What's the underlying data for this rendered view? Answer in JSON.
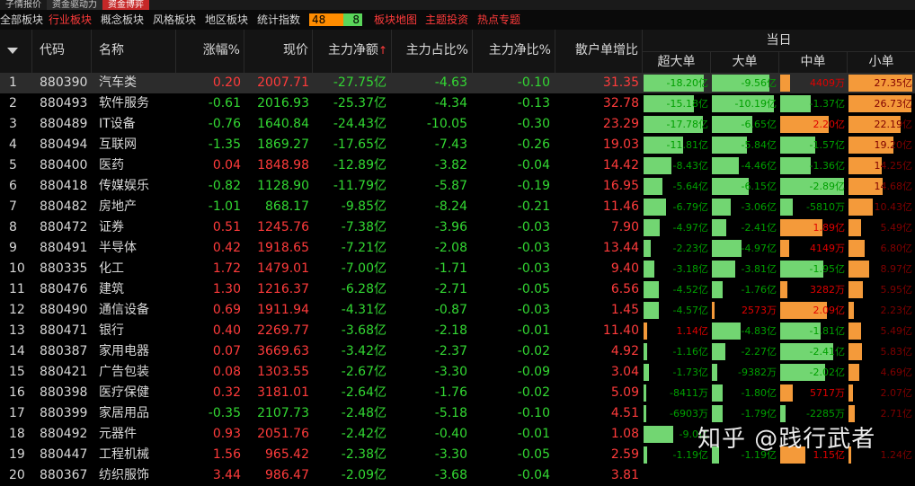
{
  "top_tabs": [
    "子情报价",
    "资金驱动力",
    "资金博弈"
  ],
  "categories": [
    "全部板块",
    "行业板块",
    "概念板块",
    "风格板块",
    "地区板块",
    "统计指数"
  ],
  "ratio_bar": {
    "up": "48",
    "down": "8"
  },
  "links": [
    "板块地图",
    "主题投资",
    "热点专题"
  ],
  "headers": {
    "code": "代码",
    "name": "名称",
    "chg": "涨幅%",
    "price": "现价",
    "net": "主力净额",
    "pct": "主力占比%",
    "net_ratio": "主力净比%",
    "retail": "散户单增比",
    "group": "当日",
    "xl": "超大单",
    "l": "大单",
    "m": "中单",
    "s": "小单"
  },
  "colors": {
    "up": "#ff3b3b",
    "down": "#33d833",
    "green_bar": "#72d672",
    "orange_bar": "#f49a3a"
  },
  "rows": [
    {
      "no": "1",
      "code": "880390",
      "name": "汽车类",
      "chg": "0.20",
      "price": "2007.71",
      "net": "-27.75亿",
      "pct": "-4.63",
      "nr": "-0.10",
      "retail": "31.35",
      "xl": "-18.20亿",
      "l": "-9.56亿",
      "m": "4409万",
      "s": "27.35亿"
    },
    {
      "no": "2",
      "code": "880493",
      "name": "软件服务",
      "chg": "-0.61",
      "price": "2016.93",
      "net": "-25.37亿",
      "pct": "-4.34",
      "nr": "-0.13",
      "retail": "32.78",
      "xl": "-15.18亿",
      "l": "-10.19亿",
      "m": "-1.37亿",
      "s": "26.73亿"
    },
    {
      "no": "3",
      "code": "880489",
      "name": "IT设备",
      "chg": "-0.76",
      "price": "1640.84",
      "net": "-24.43亿",
      "pct": "-10.05",
      "nr": "-0.30",
      "retail": "23.29",
      "xl": "-17.78亿",
      "l": "-6.65亿",
      "m": "2.20亿",
      "s": "22.19亿"
    },
    {
      "no": "4",
      "code": "880494",
      "name": "互联网",
      "chg": "-1.35",
      "price": "1869.27",
      "net": "-17.65亿",
      "pct": "-7.43",
      "nr": "-0.26",
      "retail": "19.03",
      "xl": "-11.81亿",
      "l": "-5.84亿",
      "m": "-1.57亿",
      "s": "19.20亿"
    },
    {
      "no": "5",
      "code": "880400",
      "name": "医药",
      "chg": "0.04",
      "price": "1848.98",
      "net": "-12.89亿",
      "pct": "-3.82",
      "nr": "-0.04",
      "retail": "14.42",
      "xl": "-8.43亿",
      "l": "-4.46亿",
      "m": "-1.36亿",
      "s": "14.25亿"
    },
    {
      "no": "6",
      "code": "880418",
      "name": "传媒娱乐",
      "chg": "-0.82",
      "price": "1128.90",
      "net": "-11.79亿",
      "pct": "-5.87",
      "nr": "-0.19",
      "retail": "16.95",
      "xl": "-5.64亿",
      "l": "-6.15亿",
      "m": "-2.89亿",
      "s": "14.68亿"
    },
    {
      "no": "7",
      "code": "880482",
      "name": "房地产",
      "chg": "-1.01",
      "price": "868.17",
      "net": "-9.85亿",
      "pct": "-8.24",
      "nr": "-0.21",
      "retail": "11.46",
      "xl": "-6.79亿",
      "l": "-3.06亿",
      "m": "-5810万",
      "s": "10.43亿"
    },
    {
      "no": "8",
      "code": "880472",
      "name": "证券",
      "chg": "0.51",
      "price": "1245.76",
      "net": "-7.38亿",
      "pct": "-3.96",
      "nr": "-0.03",
      "retail": "7.90",
      "xl": "-4.97亿",
      "l": "-2.41亿",
      "m": "1.89亿",
      "s": "5.49亿"
    },
    {
      "no": "9",
      "code": "880491",
      "name": "半导体",
      "chg": "0.42",
      "price": "1918.65",
      "net": "-7.21亿",
      "pct": "-2.08",
      "nr": "-0.03",
      "retail": "13.44",
      "xl": "-2.23亿",
      "l": "-4.97亿",
      "m": "4149万",
      "s": "6.80亿"
    },
    {
      "no": "10",
      "code": "880335",
      "name": "化工",
      "chg": "1.72",
      "price": "1479.01",
      "net": "-7.00亿",
      "pct": "-1.71",
      "nr": "-0.03",
      "retail": "9.40",
      "xl": "-3.18亿",
      "l": "-3.81亿",
      "m": "-1.95亿",
      "s": "8.97亿"
    },
    {
      "no": "11",
      "code": "880476",
      "name": "建筑",
      "chg": "1.30",
      "price": "1216.37",
      "net": "-6.28亿",
      "pct": "-2.71",
      "nr": "-0.05",
      "retail": "6.56",
      "xl": "-4.52亿",
      "l": "-1.76亿",
      "m": "3282万",
      "s": "5.95亿"
    },
    {
      "no": "12",
      "code": "880490",
      "name": "通信设备",
      "chg": "0.69",
      "price": "1911.94",
      "net": "-4.31亿",
      "pct": "-0.87",
      "nr": "-0.03",
      "retail": "1.45",
      "xl": "-4.57亿",
      "l": "2573万",
      "m": "2.09亿",
      "s": "2.23亿"
    },
    {
      "no": "13",
      "code": "880471",
      "name": "银行",
      "chg": "0.40",
      "price": "2269.77",
      "net": "-3.68亿",
      "pct": "-2.18",
      "nr": "-0.01",
      "retail": "11.40",
      "xl": "1.14亿",
      "l": "-4.83亿",
      "m": "-1.81亿",
      "s": "5.49亿"
    },
    {
      "no": "14",
      "code": "880387",
      "name": "家用电器",
      "chg": "0.07",
      "price": "3669.63",
      "net": "-3.42亿",
      "pct": "-2.37",
      "nr": "-0.02",
      "retail": "4.92",
      "xl": "-1.16亿",
      "l": "-2.27亿",
      "m": "-2.41亿",
      "s": "5.83亿"
    },
    {
      "no": "15",
      "code": "880421",
      "name": "广告包装",
      "chg": "0.08",
      "price": "1303.55",
      "net": "-2.67亿",
      "pct": "-3.30",
      "nr": "-0.09",
      "retail": "3.04",
      "xl": "-1.73亿",
      "l": "-9382万",
      "m": "-2.02亿",
      "s": "4.69亿"
    },
    {
      "no": "16",
      "code": "880398",
      "name": "医疗保健",
      "chg": "0.32",
      "price": "3181.01",
      "net": "-2.64亿",
      "pct": "-1.76",
      "nr": "-0.02",
      "retail": "5.09",
      "xl": "-8411万",
      "l": "-1.80亿",
      "m": "5717万",
      "s": "2.07亿"
    },
    {
      "no": "17",
      "code": "880399",
      "name": "家居用品",
      "chg": "-0.35",
      "price": "2107.73",
      "net": "-2.48亿",
      "pct": "-5.18",
      "nr": "-0.10",
      "retail": "4.51",
      "xl": "-6903万",
      "l": "-1.79亿",
      "m": "-2285万",
      "s": "2.71亿"
    },
    {
      "no": "18",
      "code": "880492",
      "name": "元器件",
      "chg": "0.93",
      "price": "2051.76",
      "net": "-2.42亿",
      "pct": "-0.40",
      "nr": "-0.01",
      "retail": "1.08",
      "xl": "-9.0亿",
      "l": "",
      "m": "",
      "s": ""
    },
    {
      "no": "19",
      "code": "880447",
      "name": "工程机械",
      "chg": "1.56",
      "price": "965.42",
      "net": "-2.38亿",
      "pct": "-3.30",
      "nr": "-0.05",
      "retail": "2.59",
      "xl": "-1.19亿",
      "l": "-1.19亿",
      "m": "1.15亿",
      "s": "1.24亿"
    },
    {
      "no": "20",
      "code": "880367",
      "name": "纺织服饰",
      "chg": "3.44",
      "price": "986.47",
      "net": "-2.09亿",
      "pct": "-3.68",
      "nr": "-0.04",
      "retail": "3.81",
      "xl": "",
      "l": "",
      "m": "",
      "s": ""
    }
  ],
  "watermark": "知乎 @践行武者"
}
